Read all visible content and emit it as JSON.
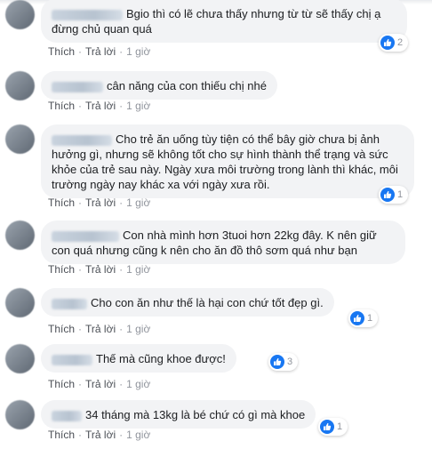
{
  "colors": {
    "bubble": "#f2f3f5",
    "like": "#1877f2",
    "meta": "#90949c"
  },
  "labels": {
    "like": "Thích",
    "reply": "Trả lời",
    "separator": "·"
  },
  "comments": [
    {
      "text": "Bgio thì có lẽ chưa thấy nhưng từ từ sẽ thấy chị ạ đừng chủ quan quá",
      "time": "1 giờ",
      "reactions": "2"
    },
    {
      "text": "cân năng của con thiếu chị nhé",
      "time": "1 giờ",
      "reactions": ""
    },
    {
      "text": "Cho trẻ ăn uống tùy tiện có thể bây giờ chưa bị ảnh hưởng gì, nhưng sẽ không tốt cho sự hình thành thể trạng và sức khỏe của trẻ sau này. Ngày xưa môi trường trong lành thì khác, môi trường ngày nay khác xa với ngày xưa rồi.",
      "time": "1 giờ",
      "reactions": "1"
    },
    {
      "text": "Con nhà mình hơn 3tuoi hơn 22kg đây. K nên giữ con quá nhưng cũng k nên cho ăn đồ thô sơm quá như bạn",
      "time": "1 giờ",
      "reactions": ""
    },
    {
      "text": "Cho con ăn như thế là hại con chứ tốt đẹp gì.",
      "time": "1 giờ",
      "reactions": "1"
    },
    {
      "text": "Thế mà cũng khoe được!",
      "time": "1 giờ",
      "reactions": "3"
    },
    {
      "text": "34 tháng mà 13kg là bé chứ có gì mà khoe",
      "time": "1 giờ",
      "reactions": "1"
    }
  ]
}
